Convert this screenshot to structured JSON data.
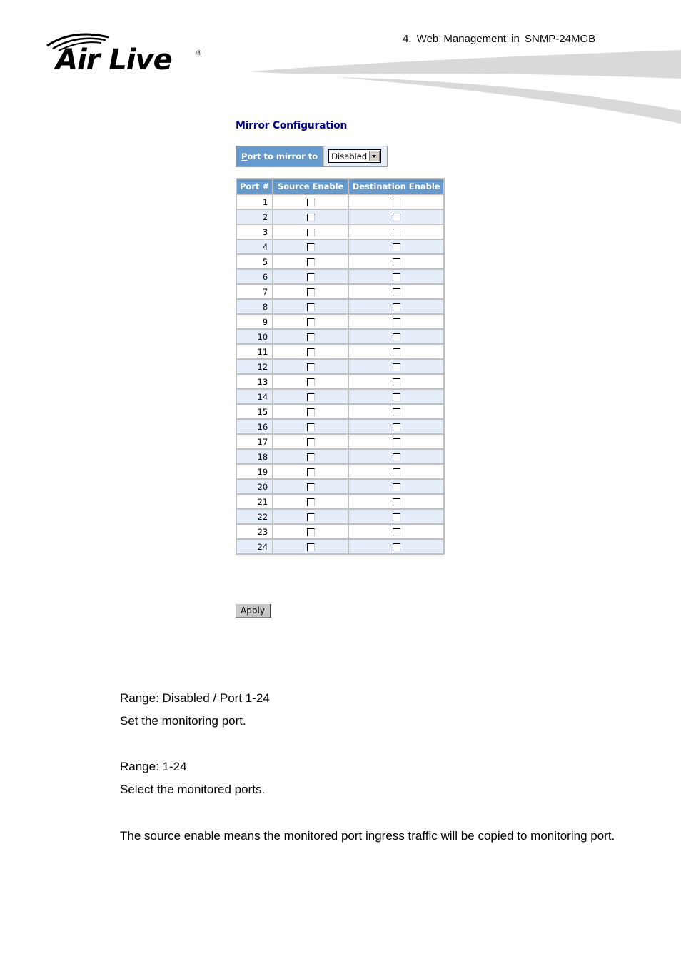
{
  "header": {
    "logo_text": "Air Live",
    "logo_mark": "®",
    "title": "4.   Web Management in SNMP-24MGB"
  },
  "mirror": {
    "title": "Mirror Configuration",
    "port_to_mirror_label_accesskey": "P",
    "port_to_mirror_label_rest": "ort to mirror to",
    "port_to_mirror_value": "Disabled",
    "table_headers": [
      "Port #",
      "Source Enable",
      "Destination Enable"
    ],
    "rows": [
      {
        "port": "1",
        "source": false,
        "destination": false
      },
      {
        "port": "2",
        "source": false,
        "destination": false
      },
      {
        "port": "3",
        "source": false,
        "destination": false
      },
      {
        "port": "4",
        "source": false,
        "destination": false
      },
      {
        "port": "5",
        "source": false,
        "destination": false
      },
      {
        "port": "6",
        "source": false,
        "destination": false
      },
      {
        "port": "7",
        "source": false,
        "destination": false
      },
      {
        "port": "8",
        "source": false,
        "destination": false
      },
      {
        "port": "9",
        "source": false,
        "destination": false
      },
      {
        "port": "10",
        "source": false,
        "destination": false
      },
      {
        "port": "11",
        "source": false,
        "destination": false
      },
      {
        "port": "12",
        "source": false,
        "destination": false
      },
      {
        "port": "13",
        "source": false,
        "destination": false
      },
      {
        "port": "14",
        "source": false,
        "destination": false
      },
      {
        "port": "15",
        "source": false,
        "destination": false
      },
      {
        "port": "16",
        "source": false,
        "destination": false
      },
      {
        "port": "17",
        "source": false,
        "destination": false
      },
      {
        "port": "18",
        "source": false,
        "destination": false
      },
      {
        "port": "19",
        "source": false,
        "destination": false
      },
      {
        "port": "20",
        "source": false,
        "destination": false
      },
      {
        "port": "21",
        "source": false,
        "destination": false
      },
      {
        "port": "22",
        "source": false,
        "destination": false
      },
      {
        "port": "23",
        "source": false,
        "destination": false
      },
      {
        "port": "24",
        "source": false,
        "destination": false
      }
    ],
    "apply_label": "Apply"
  },
  "description": {
    "range1": "Range: Disabled / Port 1-24",
    "desc1": "Set the monitoring port.",
    "range2": "Range: 1-24",
    "desc2": "Select the monitored ports.",
    "para": "The source enable means the monitored port ingress traffic will be copied to monitoring port."
  },
  "colors": {
    "header_bg": "#6699cc",
    "alt_row_bg": "#e6eefa",
    "title_color": "#000080"
  }
}
